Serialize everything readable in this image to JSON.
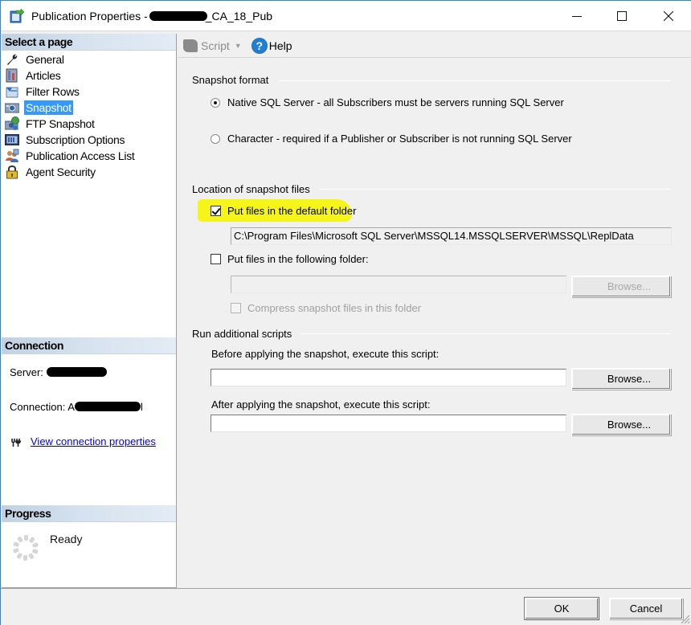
{
  "window": {
    "title_prefix": "Publication Properties -",
    "title_suffix": "_CA_18_Pub",
    "controls": {
      "minimize": "minimize",
      "maximize": "maximize",
      "close": "close"
    }
  },
  "sidebar": {
    "select_page_heading": "Select a page",
    "pages": [
      {
        "label": "General",
        "icon": "wrench-icon",
        "selected": false
      },
      {
        "label": "Articles",
        "icon": "articles-icon",
        "selected": false
      },
      {
        "label": "Filter Rows",
        "icon": "filter-rows-icon",
        "selected": false
      },
      {
        "label": "Snapshot",
        "icon": "snapshot-icon",
        "selected": true
      },
      {
        "label": "FTP Snapshot",
        "icon": "ftp-snapshot-icon",
        "selected": false
      },
      {
        "label": "Subscription Options",
        "icon": "subscription-options-icon",
        "selected": false
      },
      {
        "label": "Publication Access List",
        "icon": "users-icon",
        "selected": false
      },
      {
        "label": "Agent Security",
        "icon": "lock-icon",
        "selected": false
      }
    ],
    "connection": {
      "heading": "Connection",
      "server_label": "Server:",
      "connection_label": "Connection:",
      "connection_visible_prefix": "A",
      "connection_visible_suffix": "l",
      "link_label": "View connection properties"
    },
    "progress": {
      "heading": "Progress",
      "status": "Ready"
    }
  },
  "toolbar": {
    "script_label": "Script",
    "help_label": "Help"
  },
  "snapshot_format": {
    "title": "Snapshot format",
    "options": [
      {
        "label": "Native SQL Server - all Subscribers must be servers running SQL Server",
        "checked": true
      },
      {
        "label": "Character - required if a Publisher or Subscriber is not running SQL Server",
        "checked": false
      }
    ]
  },
  "location": {
    "title": "Location of snapshot files",
    "default_folder_label": "Put files in the default folder",
    "default_folder_checked": true,
    "default_folder_path": "C:\\Program Files\\Microsoft SQL Server\\MSSQL14.MSSQLSERVER\\MSSQL\\ReplData",
    "following_folder_label": "Put files in the following folder:",
    "following_folder_checked": false,
    "following_folder_value": "",
    "browse_label": "Browse...",
    "compress_label": "Compress snapshot files in this folder",
    "compress_checked": false
  },
  "scripts": {
    "title": "Run additional scripts",
    "before_label": "Before applying the snapshot, execute this script:",
    "before_value": "",
    "after_label": "After applying the snapshot, execute this script:",
    "after_value": "",
    "browse_label": "Browse..."
  },
  "footer": {
    "ok_label": "OK",
    "cancel_label": "Cancel"
  },
  "colors": {
    "selection": "#3399ff",
    "highlight": "#f4f40e",
    "link": "#0000ee",
    "window_border": "#2b8ad6"
  }
}
